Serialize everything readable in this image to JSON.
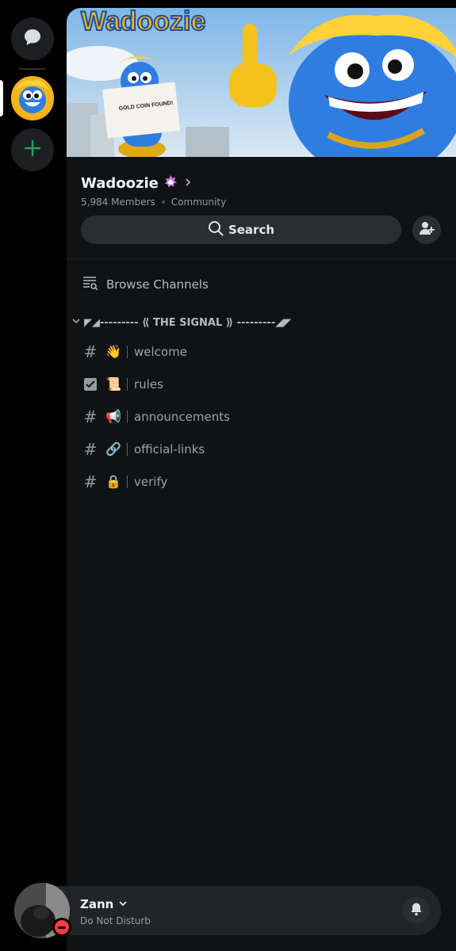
{
  "rail": {
    "items": [
      {
        "name": "direct-messages",
        "icon": "chat-bubble-icon"
      },
      {
        "name": "wadoozie-server",
        "icon": "server-avatar",
        "selected": true
      },
      {
        "name": "add-server",
        "icon": "plus-icon",
        "color": "#23a55a"
      }
    ]
  },
  "banner": {
    "logo_text": "Wadoozie",
    "newspaper_headline": "GOLD COIN FOUND!"
  },
  "server": {
    "name": "Wadoozie",
    "members": "5,984 Members",
    "type": "Community"
  },
  "search": {
    "label": "Search"
  },
  "browse": {
    "label": "Browse Channels"
  },
  "category": {
    "label": "◤◢--------- ⟪ THE SIGNAL ⟫ ---------◢◤"
  },
  "channels": [
    {
      "icon": "hash-icon",
      "emoji": "👋",
      "name": "welcome"
    },
    {
      "icon": "rules-icon",
      "emoji": "📜",
      "name": "rules"
    },
    {
      "icon": "hash-icon",
      "emoji": "📢",
      "name": "announcements"
    },
    {
      "icon": "hash-icon",
      "emoji": "🔗",
      "name": "official-links"
    },
    {
      "icon": "hash-icon",
      "emoji": "🔒",
      "name": "verify"
    }
  ],
  "user": {
    "name": "Zann",
    "status": "Do Not Disturb"
  },
  "colors": {
    "dnd": "#f23f43",
    "add_server": "#23a55a",
    "boost": "#c377e0"
  }
}
